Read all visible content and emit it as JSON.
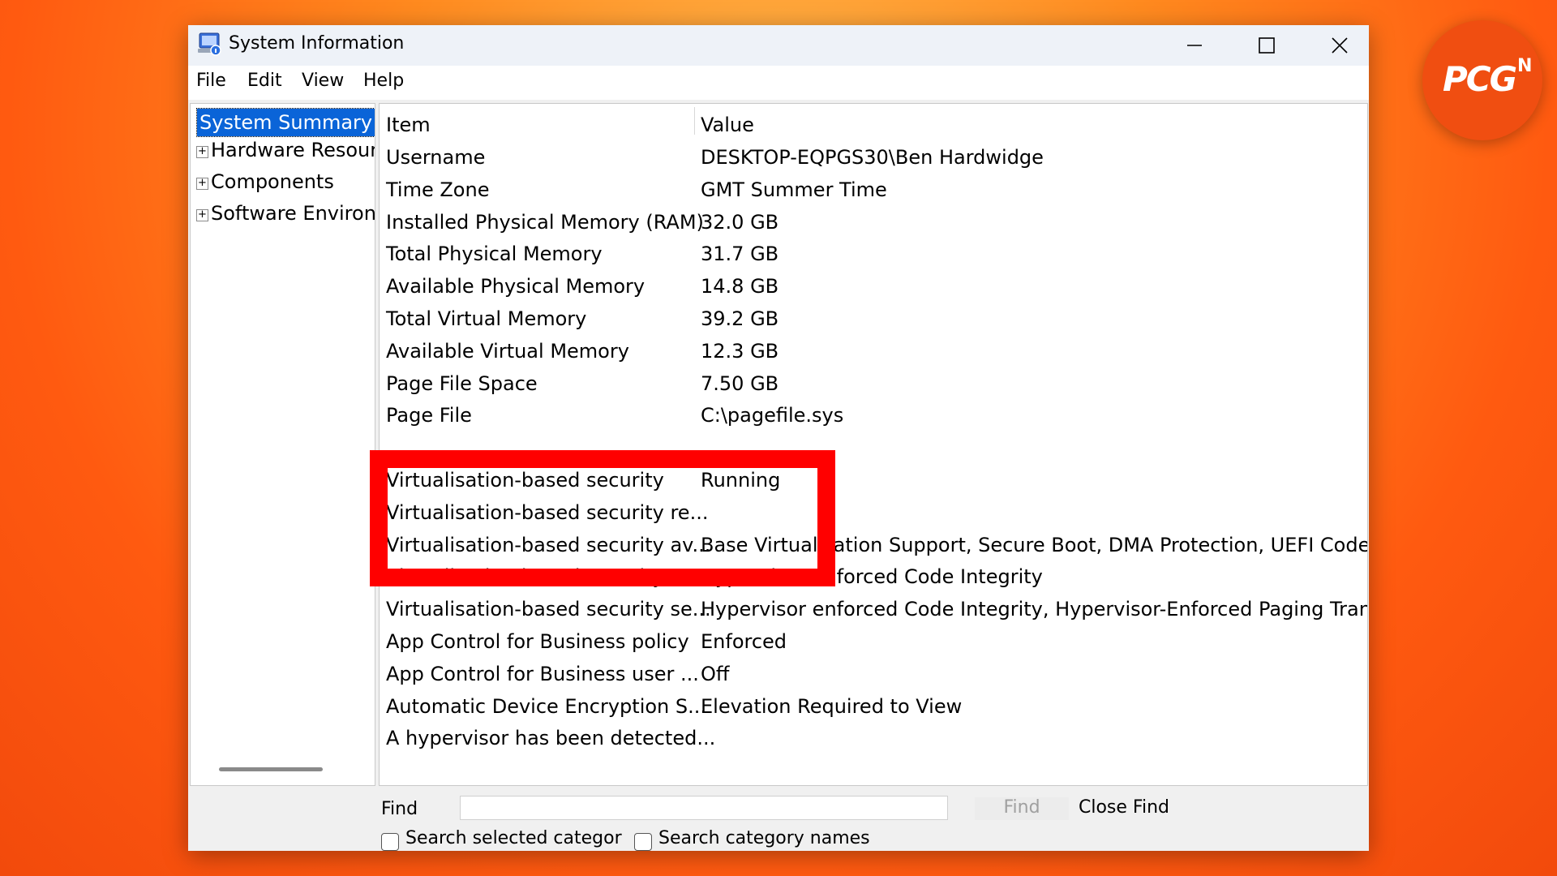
{
  "window": {
    "title": "System Information",
    "menu": [
      "File",
      "Edit",
      "View",
      "Help"
    ]
  },
  "tree": {
    "selected": "System Summary",
    "nodes": [
      "Hardware Resourc",
      "Components",
      "Software Environn"
    ]
  },
  "details": {
    "headers": {
      "item": "Item",
      "value": "Value"
    },
    "rows": [
      {
        "item": "Username",
        "value": "DESKTOP-EQPGS30\\Ben Hardwidge"
      },
      {
        "item": "Time Zone",
        "value": "GMT Summer Time"
      },
      {
        "item": "Installed Physical Memory (RAM)",
        "value": "32.0 GB"
      },
      {
        "item": "Total Physical Memory",
        "value": "31.7 GB"
      },
      {
        "item": "Available Physical Memory",
        "value": "14.8 GB"
      },
      {
        "item": "Total Virtual Memory",
        "value": "39.2 GB"
      },
      {
        "item": "Available Virtual Memory",
        "value": "12.3 GB"
      },
      {
        "item": "Page File Space",
        "value": "7.50 GB"
      },
      {
        "item": "Page File",
        "value": "C:\\pagefile.sys"
      },
      {
        "item": "",
        "value": ""
      },
      {
        "item": "Virtualisation-based security",
        "value": "Running"
      },
      {
        "item": "Virtualisation-based security re...",
        "value": ""
      },
      {
        "item": "Virtualisation-based security av...",
        "value": "Base Virtualisation Support, Secure Boot, DMA Protection, UEFI Code"
      },
      {
        "item": "Virtualisation-based security se...",
        "value": "Hypervisor enforced Code Integrity"
      },
      {
        "item": "Virtualisation-based security se...",
        "value": "Hypervisor enforced Code Integrity, Hypervisor-Enforced Paging Tran"
      },
      {
        "item": "App Control for Business policy",
        "value": "Enforced"
      },
      {
        "item": "App Control for Business user ...",
        "value": "Off"
      },
      {
        "item": "Automatic Device Encryption S...",
        "value": "Elevation Required to View"
      },
      {
        "item": "A hypervisor has been detected...",
        "value": ""
      }
    ]
  },
  "find_bar": {
    "label": "Find",
    "input_value": "",
    "find_button": "Find",
    "close_find_button": "Close Find",
    "search_selected_category": "Search selected categor",
    "search_category_names": "Search category names"
  },
  "brand": {
    "logo_text": "PCG",
    "logo_suffix": "N"
  }
}
